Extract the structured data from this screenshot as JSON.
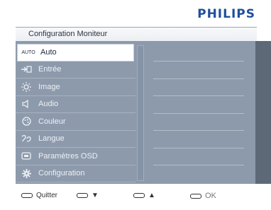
{
  "brand": "PHILIPS",
  "header": {
    "title": "Configuration Moniteur"
  },
  "menu": {
    "items": [
      {
        "label": "Auto",
        "icon": "AUTO",
        "selected": true
      },
      {
        "label": "Entrée",
        "icon": "input-icon"
      },
      {
        "label": "Image",
        "icon": "brightness-icon"
      },
      {
        "label": "Audio",
        "icon": "speaker-icon"
      },
      {
        "label": "Couleur",
        "icon": "color-wheel-icon"
      },
      {
        "label": "Langue",
        "icon": "language-icon"
      },
      {
        "label": "Paramètres OSD",
        "icon": "osd-icon"
      },
      {
        "label": "Configuration",
        "icon": "gear-icon"
      }
    ]
  },
  "footer": {
    "quit_label": "Quitter",
    "down_label": "▼",
    "up_label": "▲",
    "ok_label": "OK"
  },
  "colors": {
    "brand": "#1f4f9c",
    "panel": "#8d9aac",
    "strip": "#5e6978"
  }
}
